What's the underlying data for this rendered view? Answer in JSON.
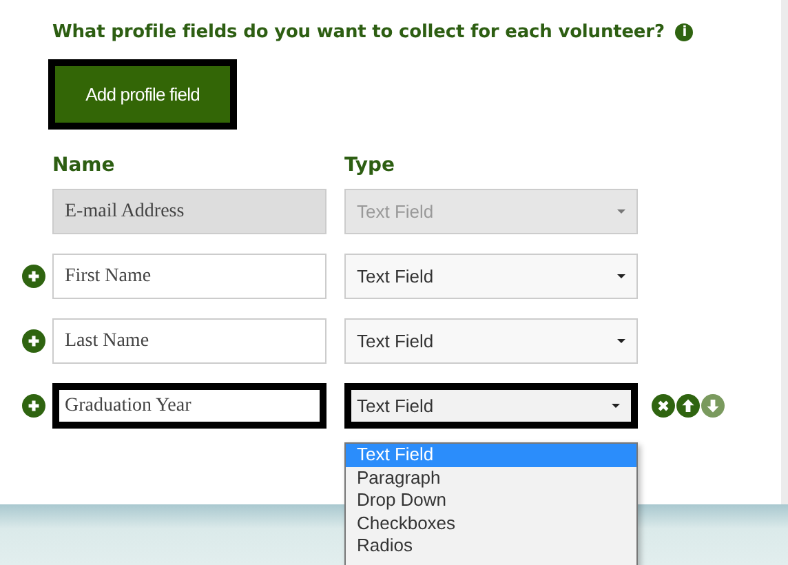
{
  "heading": {
    "text": "What profile fields do you want to collect for each volunteer?",
    "info_label": "i"
  },
  "add_button": {
    "label": "Add profile field",
    "focused": true
  },
  "columns": [
    "Name",
    "Type"
  ],
  "rows": [
    {
      "name": "E-mail Address",
      "type": "Text Field",
      "disabled": true,
      "focused": false,
      "addable": false,
      "open": false,
      "actions": []
    },
    {
      "name": "First Name",
      "type": "Text Field",
      "disabled": false,
      "focused": false,
      "addable": true,
      "open": false,
      "actions": []
    },
    {
      "name": "Last Name",
      "type": "Text Field",
      "disabled": false,
      "focused": false,
      "addable": true,
      "open": false,
      "actions": []
    },
    {
      "name": "Graduation Year",
      "type": "Text Field",
      "disabled": false,
      "focused": true,
      "addable": true,
      "open": true,
      "actions": [
        {
          "kind": "remove",
          "disabled": false
        },
        {
          "kind": "up",
          "disabled": false
        },
        {
          "kind": "down",
          "disabled": true
        }
      ]
    }
  ],
  "dropdown_options": [
    {
      "label": "Text Field",
      "selected": true
    },
    {
      "label": "Paragraph",
      "selected": false
    },
    {
      "label": "Drop Down",
      "selected": false
    },
    {
      "label": "Checkboxes",
      "selected": false
    },
    {
      "label": "Radios",
      "selected": false
    }
  ]
}
